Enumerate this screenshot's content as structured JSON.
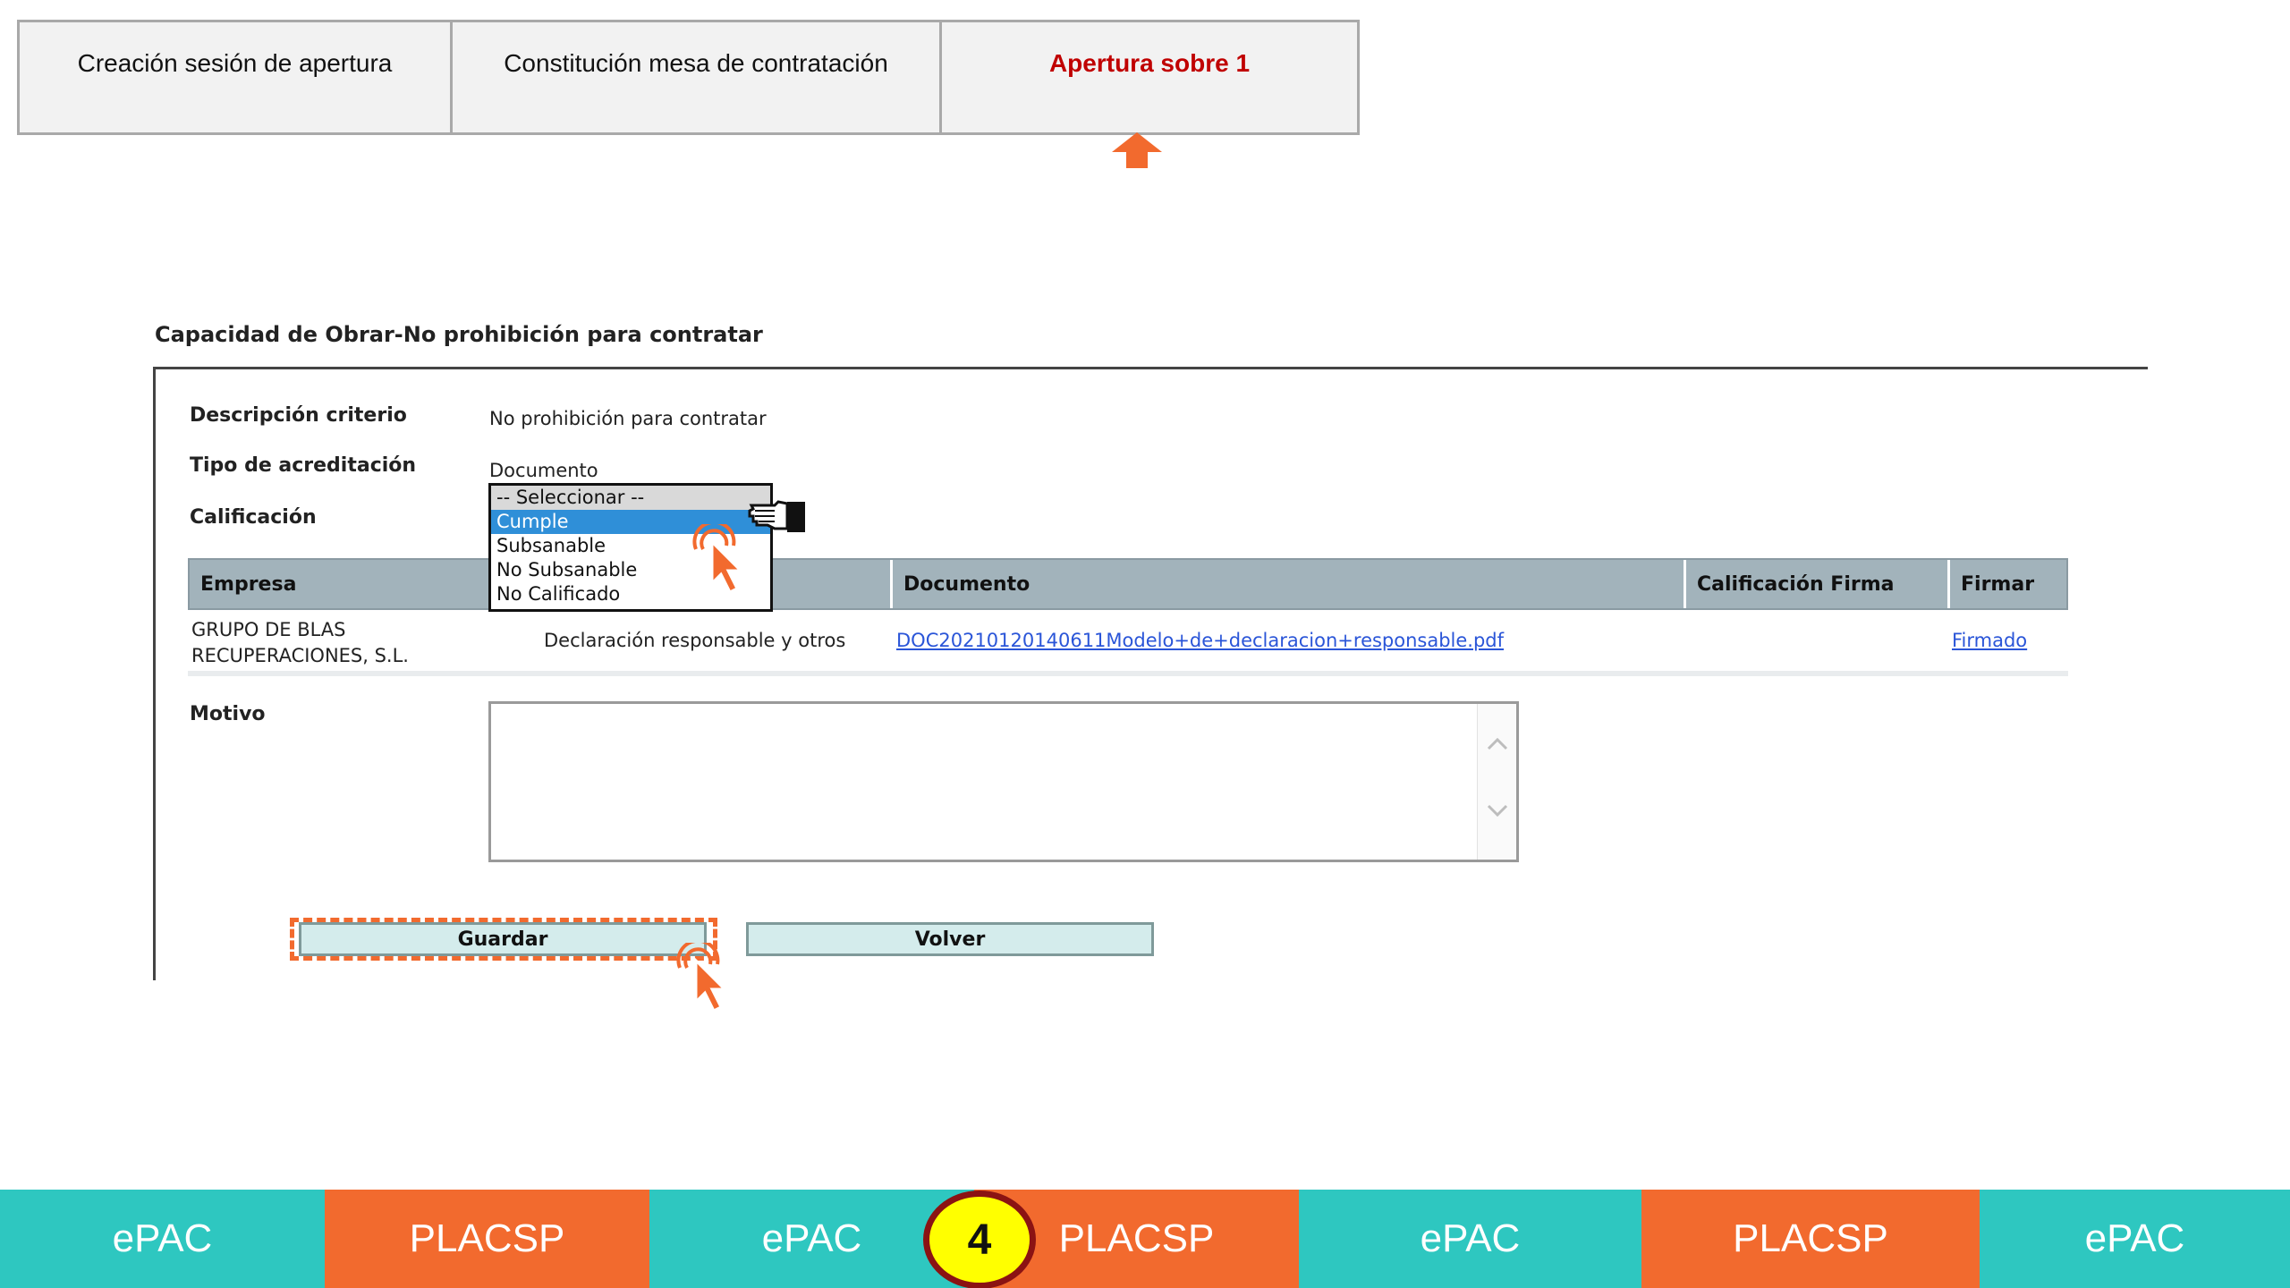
{
  "steps": [
    {
      "label": "Creación sesión de apertura",
      "active": false
    },
    {
      "label": "Constitución mesa de contratación",
      "active": false
    },
    {
      "label": "Apertura sobre 1",
      "active": true
    }
  ],
  "section": {
    "title": "Capacidad de Obrar-No prohibición para contratar"
  },
  "form": {
    "descripcion_label": "Descripción criterio",
    "descripcion_value": "No prohibición para contratar",
    "tipo_label": "Tipo de acreditación",
    "tipo_value": "Documento",
    "calificacion_label": "Calificación",
    "calificacion_options": [
      "-- Seleccionar --",
      "Cumple",
      "Subsanable",
      "No Subsanable",
      "No Calificado"
    ],
    "calificacion_selected": "Cumple",
    "motivo_label": "Motivo",
    "motivo_value": ""
  },
  "table": {
    "headers": [
      "Empresa",
      "Documento",
      "Calificación Firma",
      "Firmar"
    ],
    "rows": [
      {
        "empresa_line1": "GRUPO DE BLAS",
        "empresa_line2": "RECUPERACIONES, S.L.",
        "tipo": "Declaración responsable y otros",
        "documento": "DOC20210120140611Modelo+de+declaracion+responsable.pdf",
        "calificacion_firma": "",
        "firmar": "Firmado"
      }
    ]
  },
  "buttons": {
    "guardar": "Guardar",
    "volver": "Volver"
  },
  "brandbar": {
    "items": [
      {
        "label": "ePAC",
        "color": "#2ec7c0"
      },
      {
        "label": "PLACSP",
        "color": "#f26a2e"
      },
      {
        "label": "ePAC",
        "color": "#2ec7c0"
      },
      {
        "label": "PLACSP",
        "color": "#f26a2e"
      },
      {
        "label": "ePAC",
        "color": "#2ec7c0"
      },
      {
        "label": "PLACSP",
        "color": "#f26a2e"
      },
      {
        "label": "ePAC",
        "color": "#2ec7c0"
      }
    ],
    "step_number": "4"
  },
  "colors": {
    "accent": "#f26a2e",
    "active_step": "#c00000",
    "link": "#2a55d8",
    "selection": "#2f8fd8"
  },
  "icons": [
    "up-arrow-icon",
    "hand-pointer-icon",
    "click-pointer-icon",
    "scroll-up-icon",
    "scroll-down-icon"
  ]
}
